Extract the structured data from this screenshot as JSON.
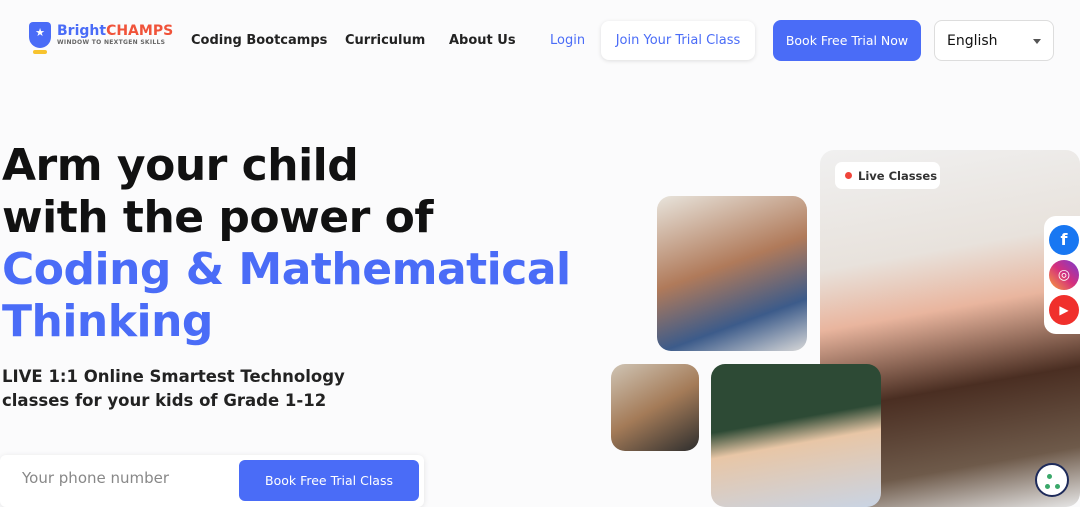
{
  "nav": {
    "brand_main": "Bright",
    "brand_accent": "CHAMPS",
    "tagline": "WINDOW TO NEXTGEN SKILLS",
    "links": [
      "Coding Bootcamps",
      "Curriculum",
      "About Us"
    ],
    "login": "Login",
    "join_trial": "Join Your Trial Class",
    "book_trial": "Book Free Trial Now",
    "language": "English"
  },
  "hero": {
    "line1": "Arm your child",
    "line2": "with the power of",
    "line3": "Coding & Mathematical",
    "line4": "Thinking",
    "subtitle": "LIVE 1:1 Online Smartest Technology classes for your kids of Grade 1-12",
    "phone_placeholder": "Your phone number",
    "cta": "Book Free Trial Class",
    "live_badge": "Live Classes"
  },
  "colors": {
    "brand": "#4a6cf7",
    "live_dot": "#f0453a"
  },
  "social": [
    "facebook-icon",
    "instagram-icon",
    "youtube-icon"
  ]
}
